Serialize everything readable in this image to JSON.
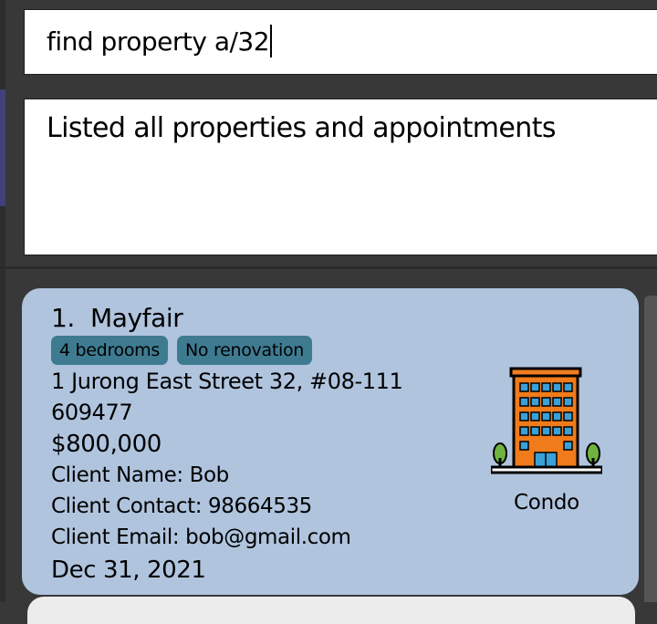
{
  "command_box": {
    "value": "find property a/32"
  },
  "result_display": {
    "message": "Listed all properties and appointments"
  },
  "property_list": {
    "cards": [
      {
        "index": "1.",
        "name": "Mayfair",
        "tags": [
          "4 bedrooms",
          "No renovation"
        ],
        "address": "1 Jurong East Street 32, #08-111",
        "postal_code": "609477",
        "price": "$800,000",
        "client_name": "Client Name: Bob",
        "client_contact": "Client Contact: 98664535",
        "client_email": "Client Email: bob@gmail.com",
        "date": "Dec 31, 2021",
        "property_type": "Condo",
        "icon": "condo-building-icon"
      }
    ]
  },
  "colors": {
    "background": "#383838",
    "card": "#b0c4de",
    "tag": "#3e7b91",
    "building_orange": "#f07b1a",
    "window_blue": "#3aa0d8"
  }
}
